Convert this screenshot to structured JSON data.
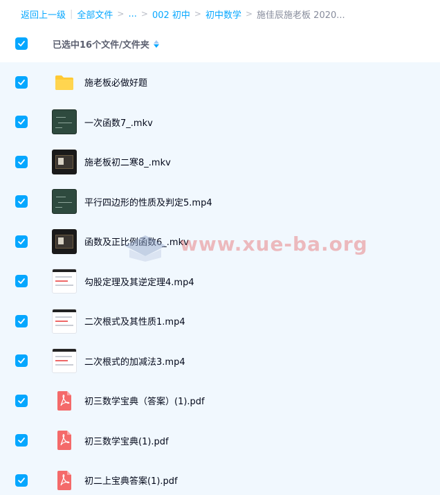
{
  "breadcrumb": {
    "back": "返回上一级",
    "all_files": "全部文件",
    "ellipsis": "...",
    "level1": "002 初中",
    "level2": "初中数学",
    "current": "施佳辰施老板 2020..."
  },
  "header": {
    "selected_text": "已选中16个文件/文件夹"
  },
  "watermark": "www.xue-ba.org",
  "files": [
    {
      "name": "施老板必做好题",
      "type": "folder"
    },
    {
      "name": "一次函数7_.mkv",
      "type": "video-board"
    },
    {
      "name": "施老板初二寒8_.mkv",
      "type": "video-dark"
    },
    {
      "name": "平行四边形的性质及判定5.mp4",
      "type": "video-board"
    },
    {
      "name": "函数及正比例函数6_.mkv",
      "type": "video-dark"
    },
    {
      "name": "勾股定理及其逆定理4.mp4",
      "type": "video-doc"
    },
    {
      "name": "二次根式及其性质1.mp4",
      "type": "video-doc"
    },
    {
      "name": "二次根式的加减法3.mp4",
      "type": "video-doc"
    },
    {
      "name": "初三数学宝典（答案）(1).pdf",
      "type": "pdf"
    },
    {
      "name": "初三数学宝典(1).pdf",
      "type": "pdf"
    },
    {
      "name": "初二上宝典答案(1).pdf",
      "type": "pdf"
    }
  ],
  "colors": {
    "accent": "#06a7ff",
    "list_bg": "#f1f8fe",
    "folder": "#ffc933",
    "pdf": "#f46a6a"
  }
}
